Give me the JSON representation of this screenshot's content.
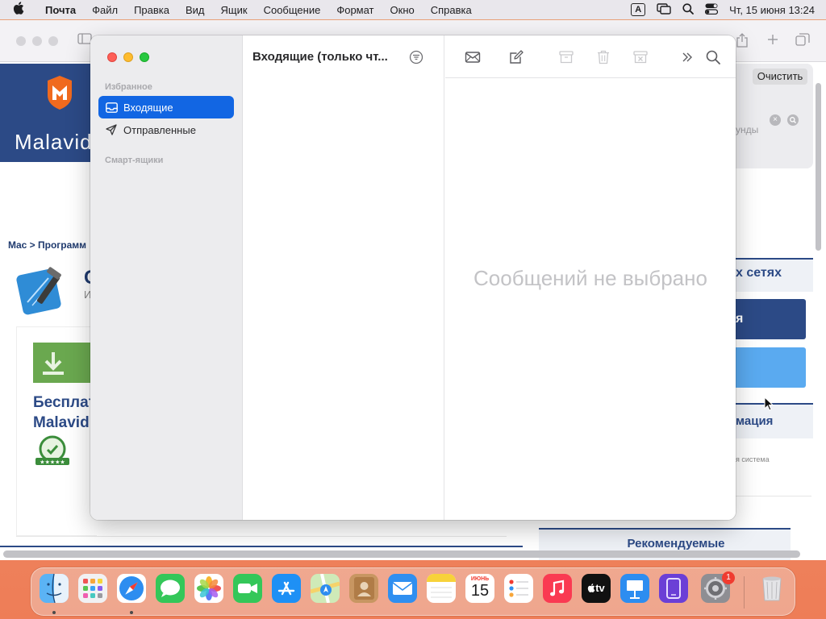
{
  "menubar": {
    "app_name": "Почта",
    "items": [
      "Файл",
      "Правка",
      "Вид",
      "Ящик",
      "Сообщение",
      "Формат",
      "Окно",
      "Справка"
    ],
    "input_indicator": "A",
    "datetime": "Чт, 15 июня  13:24"
  },
  "browser": {
    "site_name": "Malavid",
    "breadcrumb": "Mac > Программ",
    "app_initial": "C",
    "app_sub": "И",
    "free_text_line1": "Бесплат",
    "free_text_line2": "Malavid",
    "social_heading": "х сетях",
    "facebook_text": "я",
    "info_heading": "мация",
    "os_text": "я система",
    "recommended": "Рекомендуемые",
    "clear_button": "Очистить",
    "seconds_text": "унды"
  },
  "mail": {
    "sidebar": {
      "favorites_label": "Избранное",
      "items": [
        {
          "label": "Входящие",
          "selected": true,
          "icon": "inbox-icon"
        },
        {
          "label": "Отправленные",
          "selected": false,
          "icon": "paper-plane-icon"
        }
      ],
      "smart_mailboxes_label": "Смарт-ящики"
    },
    "list": {
      "title": "Входящие (только чт..."
    },
    "viewer": {
      "empty_text": "Сообщений не выбрано"
    }
  },
  "dock": {
    "calendar_month": "ИЮНЬ",
    "calendar_day": "15",
    "appletv_label": "tv",
    "settings_badge": "1",
    "apps": [
      "Finder",
      "Launchpad",
      "Safari",
      "Messages",
      "Photos",
      "FaceTime",
      "App Store",
      "Maps",
      "Contacts",
      "Mail",
      "Notes",
      "Calendar",
      "Reminders",
      "Music",
      "TV",
      "Keynote",
      "Simulator",
      "System Preferences",
      "Trash"
    ]
  },
  "colors": {
    "accent": "#1266e3",
    "site_blue": "#2c4a86"
  }
}
